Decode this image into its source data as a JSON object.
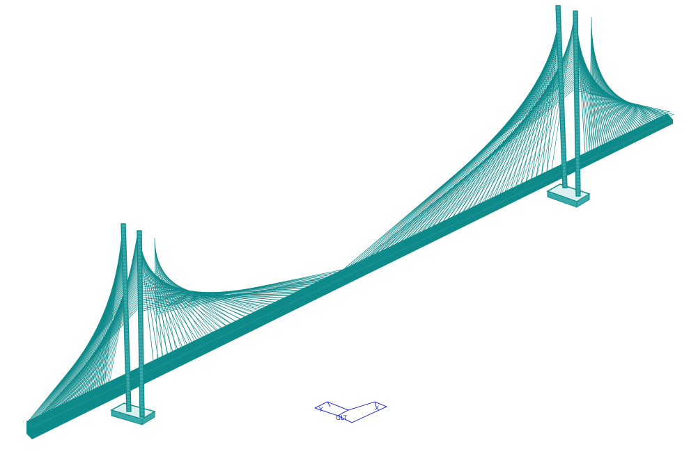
{
  "scene": {
    "subject": "cable-stayed-bridge",
    "colors": {
      "background": "#ffffff",
      "structure": "#0f8a8a",
      "structure_light": "#3aa9a9",
      "base_fill": "#d9f0ef",
      "axis_triad": "#1f2bd6"
    },
    "stay_cable_count_per_fan": 40
  },
  "axis_triad": {
    "labels": [
      "Y",
      "GLT",
      "X"
    ]
  }
}
